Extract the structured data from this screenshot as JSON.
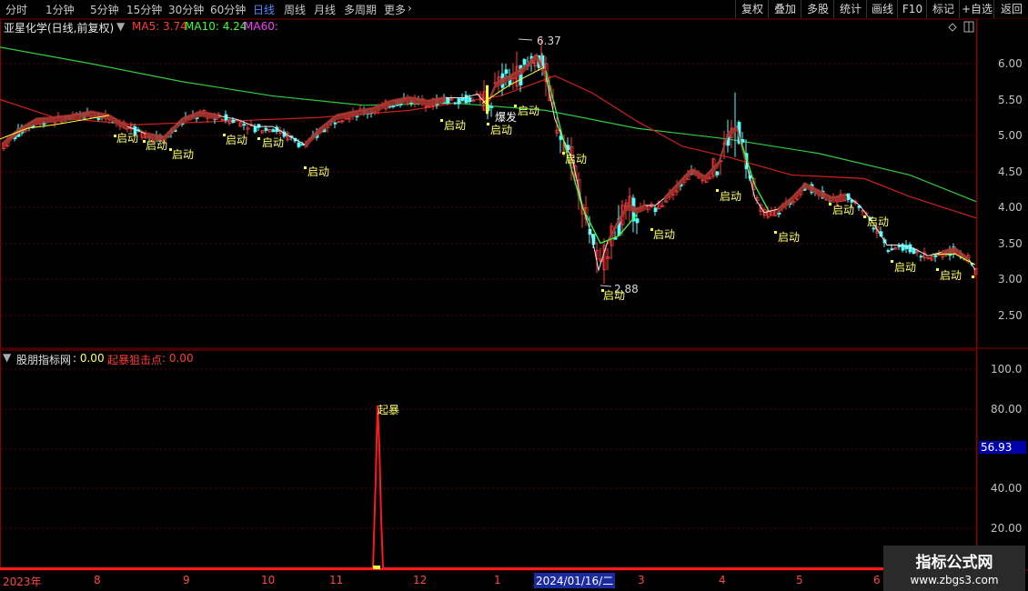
{
  "tabs": [
    "分时",
    "1分钟",
    "5分钟",
    "15分钟",
    "30分钟",
    "60分钟",
    "日线",
    "周线",
    "月线",
    "多周期",
    "更多"
  ],
  "active_tab": "日线",
  "right_buttons": [
    "复权",
    "叠加",
    "多股",
    "统计",
    "画线",
    "F10",
    "标记",
    "+自选",
    "返回"
  ],
  "main_chart": {
    "stock_title": "亚星化学(日线,前复权)",
    "ma5_label": "MA5: 3.74",
    "ma10_label": "MA10: 4.24",
    "ma60_label": "MA60:",
    "y_ticks": [
      "6.00",
      "5.50",
      "5.00",
      "4.50",
      "4.00",
      "3.50",
      "3.00",
      "2.50"
    ],
    "high_label": "6.37",
    "low_label": "2.88",
    "signal_qidong": "启动",
    "signal_baofa": "爆发"
  },
  "sub_chart": {
    "title": "股朋指标网",
    "value1": ": 0.00",
    "label2": "起暴狙击点",
    "value2": ": 0.00",
    "y_ticks": [
      "100.0",
      "80.00",
      "40.00",
      "20.00"
    ],
    "current_value": "56.93",
    "spike_label": "起暴"
  },
  "date_axis": [
    "2023年",
    "8",
    "9",
    "10",
    "11",
    "12",
    "1",
    "2024/01/16/二",
    "3",
    "4",
    "5",
    "6"
  ],
  "watermark": {
    "title": "指标公式网",
    "url": "www.zbgs3.com"
  },
  "colors": {
    "ma5": "#ffffff",
    "ma10": "#ffff00",
    "ma60": "#ff00ff",
    "up": "#ff3b3b",
    "down": "#54ffff",
    "green_line": "#2ecc40"
  }
}
